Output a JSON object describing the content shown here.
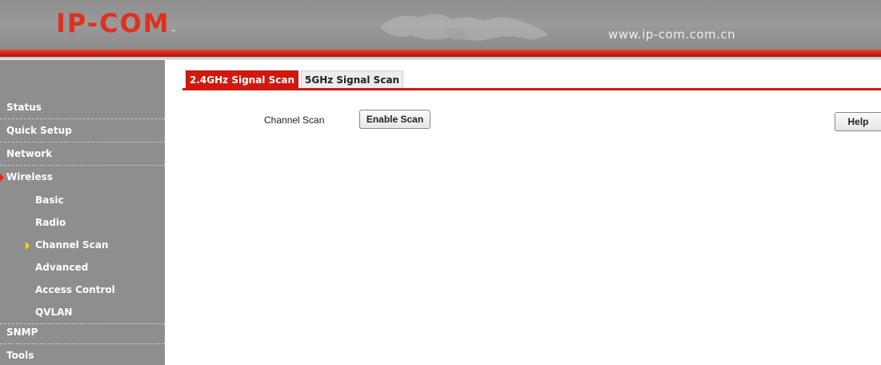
{
  "header": {
    "logo_text": "IP-COM",
    "logo_tm": "™",
    "site_url": "www.ip-com.com.cn"
  },
  "sidebar": {
    "items": [
      {
        "label": "Status"
      },
      {
        "label": "Quick Setup"
      },
      {
        "label": "Network"
      },
      {
        "label": "Wireless",
        "active": true
      },
      {
        "label": "Basic"
      },
      {
        "label": "Radio"
      },
      {
        "label": "Channel Scan",
        "active": true
      },
      {
        "label": "Advanced"
      },
      {
        "label": "Access Control"
      },
      {
        "label": "QVLAN"
      },
      {
        "label": "SNMP"
      },
      {
        "label": "Tools"
      }
    ]
  },
  "main": {
    "tabs": [
      {
        "label": "2.4GHz Signal Scan",
        "active": true
      },
      {
        "label": "5GHz Signal Scan",
        "active": false
      }
    ],
    "channel_scan_label": "Channel Scan",
    "enable_scan_button": "Enable Scan",
    "help_button": "Help"
  },
  "colors": {
    "brand_red": "#d2180e",
    "sidebar_gray": "#8e8e8e",
    "active_arrow_red": "#e8261a",
    "sub_arrow_yellow": "#ffd800"
  },
  "icons": [
    "world-map-icon",
    "active-arrow-icon",
    "sub-arrow-icon"
  ]
}
